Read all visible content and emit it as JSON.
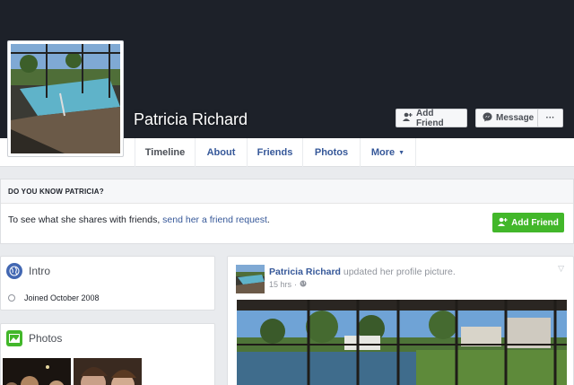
{
  "profile": {
    "name": "Patricia Richard",
    "add_friend": "Add Friend",
    "message": "Message",
    "more_dots": "···"
  },
  "tabs": [
    {
      "label": "Timeline"
    },
    {
      "label": "About"
    },
    {
      "label": "Friends"
    },
    {
      "label": "Photos"
    },
    {
      "label": "More"
    }
  ],
  "know": {
    "heading": "DO YOU KNOW PATRICIA?",
    "text_before": "To see what she shares with friends, ",
    "link": "send her a friend request",
    "text_after": ".",
    "button": "Add Friend"
  },
  "intro": {
    "title": "Intro",
    "joined": "Joined October 2008"
  },
  "photos": {
    "title": "Photos"
  },
  "post": {
    "author": "Patricia Richard",
    "action": " updated her profile picture.",
    "time": "15 hrs",
    "dot": "·"
  },
  "colors": {
    "cover_bg": "#1d2129",
    "link": "#365899",
    "green": "#42b72a",
    "blue": "#4267b2"
  },
  "icons": [
    "add-friend-icon",
    "messenger-icon",
    "globe-icon",
    "photos-icon",
    "clock-icon",
    "public-icon",
    "chevron-down-icon"
  ]
}
